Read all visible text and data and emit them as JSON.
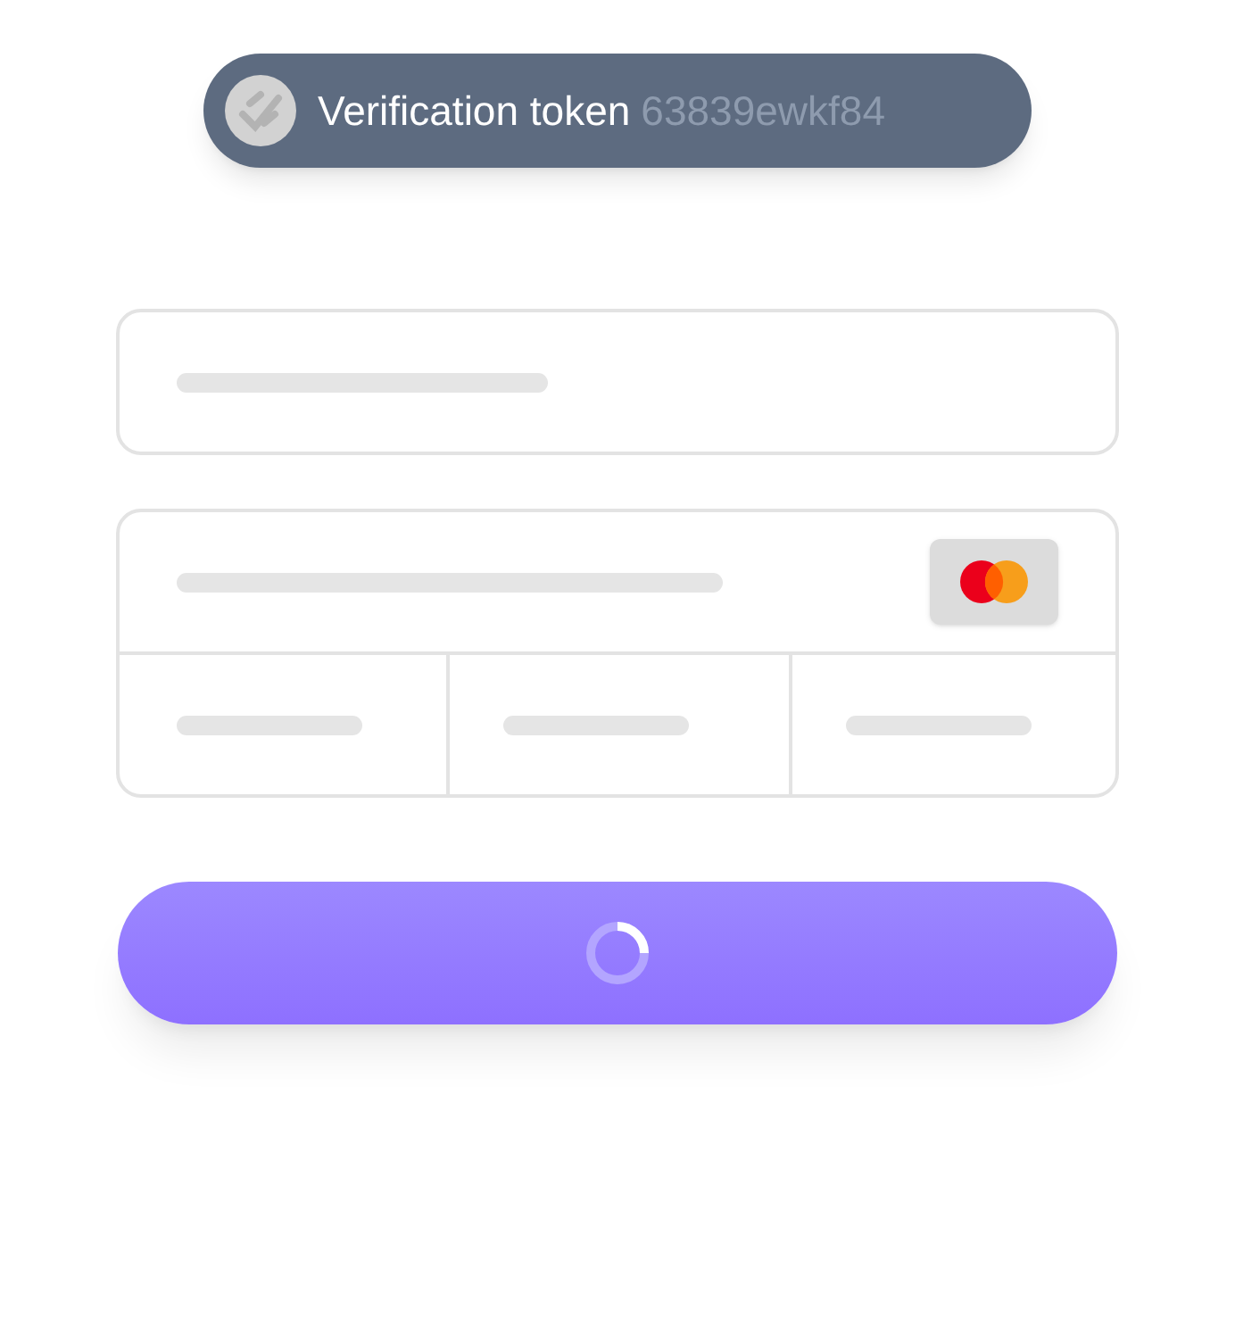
{
  "token": {
    "label": "Verification token",
    "value": "63839ewkf84"
  },
  "pay_button": {
    "loading": true
  }
}
